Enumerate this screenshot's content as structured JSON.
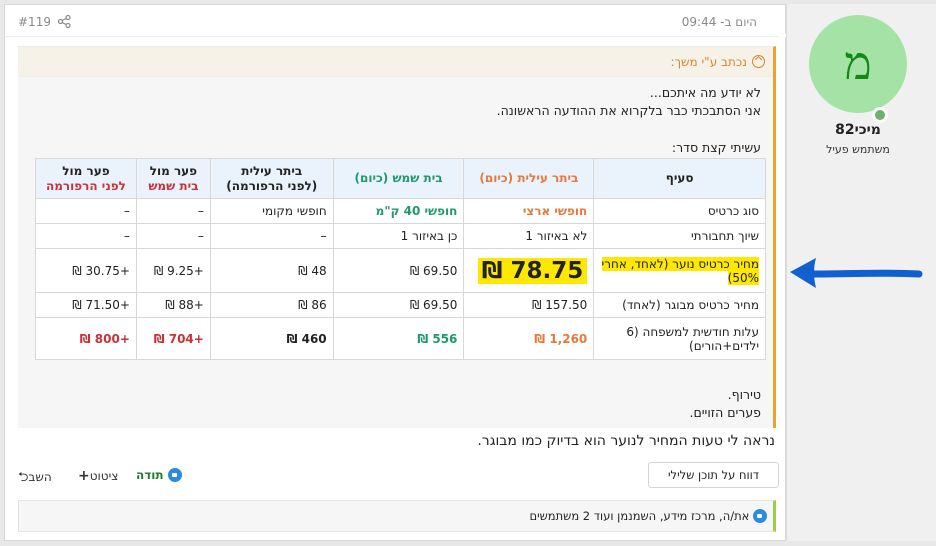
{
  "post": {
    "date": "היום ב- 09:44",
    "number": "#119",
    "body": "נראה לי טעות המחיר לנוער הוא בדיוק כמו מבוגר.",
    "report_label": "דווח על תוכן שלילי",
    "actions": {
      "reply": "השב",
      "quote": "ציטוט",
      "like": "תודה"
    },
    "likes_text": "את/ה, מרכז מידע, השמנמן ועוד 2 משתמשים"
  },
  "quote": {
    "attribution": "נכתב ע\"י משך:",
    "lines": [
      "לא יודע מה איתכם...",
      "אני הסתבכתי כבר בלקרוא את ההודעה הראשונה.",
      "עשיתי קצת סדר:",
      "טירוף.",
      "פערים הזויים."
    ]
  },
  "table": {
    "headers": [
      {
        "line1": "סעיף",
        "line2": "",
        "color": "#222222"
      },
      {
        "line1": "ביתר עילית (כיום)",
        "line2": "",
        "color": "#e8793a"
      },
      {
        "line1": "בית שמש (כיום)",
        "line2": "",
        "color": "#1f9a6a"
      },
      {
        "line1": "ביתר עילית",
        "line2": "(לפני הרפורמה)",
        "color": "#222222"
      },
      {
        "line1": "פער מול",
        "line2": "בית שמש",
        "color": "#c8323a"
      },
      {
        "line1": "פער מול",
        "line2": "לפני הרפורמה",
        "color": "#c8323a"
      }
    ],
    "rows": [
      [
        "סוג כרטיס",
        "חופשי ארצי",
        "חופשי 40 ק\"מ",
        "חופשי מקומי",
        "–",
        "–"
      ],
      [
        "שיוך תחבורתי",
        "לא באיזור 1",
        "כן באיזור 1",
        "–",
        "–",
        "–"
      ],
      [
        "מחיר כרטיס נוער (לאחד, אחרי 50%)",
        "78.75 ₪",
        "69.50 ₪",
        "48 ₪",
        "+9.25 ₪",
        "+30.75 ₪"
      ],
      [
        "מחיר כרטיס מבוגר (לאחד)",
        "157.50 ₪",
        "69.50 ₪",
        "86 ₪",
        "+88 ₪",
        "+71.50 ₪"
      ],
      [
        "עלות חודשית למשפחה (6 ילדים+הורים)",
        "1,260 ₪",
        "556 ₪",
        "460 ₪",
        "+704 ₪",
        "+800 ₪"
      ]
    ]
  },
  "author": {
    "initial": "מ",
    "name": "מיכי82",
    "title": "משתמש פעיל"
  },
  "icons": [
    "share-icon",
    "quote-up-icon",
    "reply-icon",
    "plus-icon",
    "like-icon",
    "online-status-icon",
    "blue-arrow-annotation"
  ],
  "colors": {
    "accent_orange": "#f0a030",
    "highlight_yellow": "#ffe800",
    "avatar_green": "#a5e2a5",
    "arrow_blue": "#1060d0"
  }
}
